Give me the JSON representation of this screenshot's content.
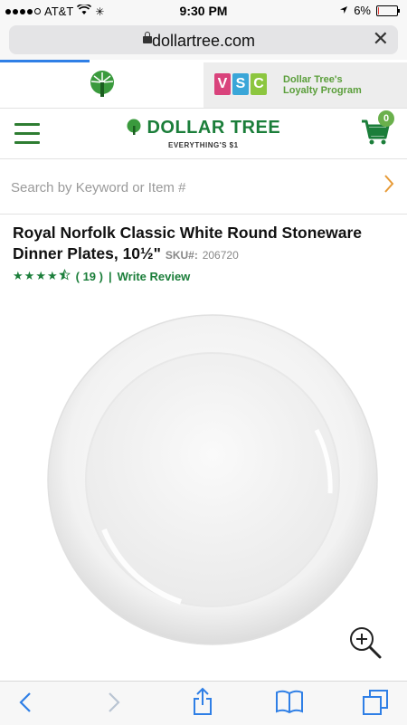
{
  "status_bar": {
    "carrier": "AT&T",
    "time": "9:30 PM",
    "battery": "6%",
    "battery_level": 0.06
  },
  "browser": {
    "url": "dollartree.com",
    "load_progress": 0.22
  },
  "brand_tabs": {
    "vsc_letters": [
      "V",
      "S",
      "C"
    ],
    "vsc_line1": "Dollar Tree's",
    "vsc_line2": "Loyalty Program"
  },
  "header": {
    "logo_text": "DOLLAR TREE",
    "logo_tagline": "EVERYTHING'S $1",
    "cart_count": "0"
  },
  "search": {
    "placeholder": "Search by Keyword or Item #"
  },
  "product": {
    "title": "Royal Norfolk Classic White Round Stoneware Dinner Plates, 10½\"",
    "sku_label": "SKU#:",
    "sku": "206720",
    "rating": 4.5,
    "review_count": "( 19 )",
    "separator": "|",
    "write_review": "Write Review"
  },
  "colors": {
    "brand_green": "#1b7e3a",
    "accent_orange": "#e79a36",
    "ios_blue": "#2f7fe6"
  }
}
